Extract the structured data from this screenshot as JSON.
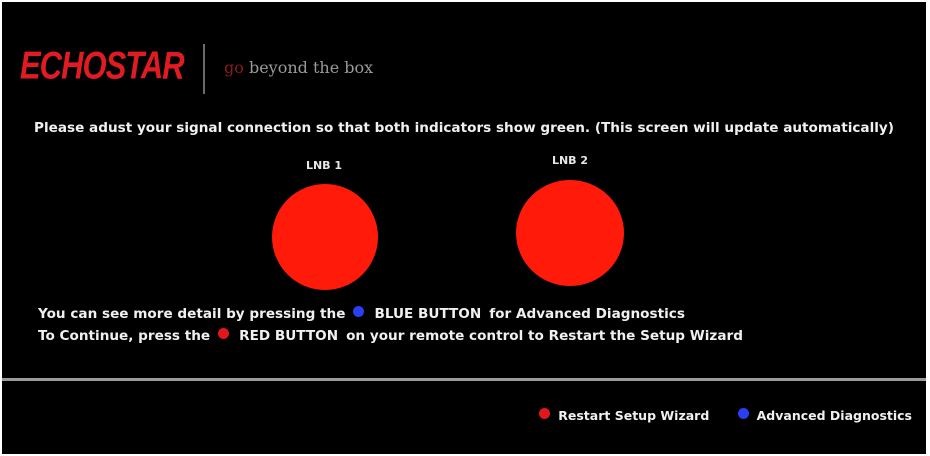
{
  "colors": {
    "background": "#000000",
    "indicator_red": "#ff1a0a",
    "red_dot": "#e5161a",
    "blue_dot": "#2b3ff2",
    "logo_red": "#e01b22"
  },
  "header": {
    "logo": "ECHOSTAR",
    "tagline_go": "go",
    "tagline_rest": " beyond the box"
  },
  "instruction": "Please adust your signal connection so that both indicators show green. (This screen will update automatically)",
  "indicators": [
    {
      "label": "LNB 1",
      "status_color": "red"
    },
    {
      "label": "LNB 2",
      "status_color": "red"
    }
  ],
  "details": {
    "line1_prefix": "You can see more detail by pressing the",
    "line1_button": "BLUE BUTTON",
    "line1_suffix": "for Advanced Diagnostics",
    "line2_prefix": "To Continue, press the",
    "line2_button": "RED BUTTON",
    "line2_suffix": "on your remote control to Restart the Setup Wizard"
  },
  "footer": {
    "restart_label": "Restart Setup Wizard",
    "diagnostics_label": "Advanced Diagnostics"
  }
}
